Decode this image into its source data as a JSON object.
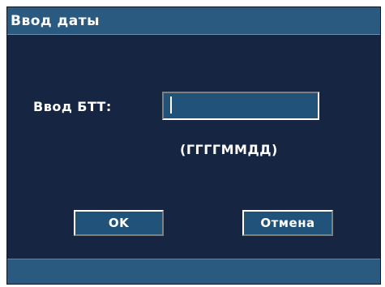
{
  "dialog": {
    "title": "Ввод даты",
    "field_label": "Ввод БТТ:",
    "date_input": {
      "value": "",
      "placeholder": ""
    },
    "format_hint": "(ГГГГММДД)",
    "ok_label": "OK",
    "cancel_label": "Отмена"
  },
  "colors": {
    "dialog_background": "#162642",
    "titlebar_background": "#2a5a80",
    "input_background": "#21527a",
    "text": "#ffffff"
  }
}
